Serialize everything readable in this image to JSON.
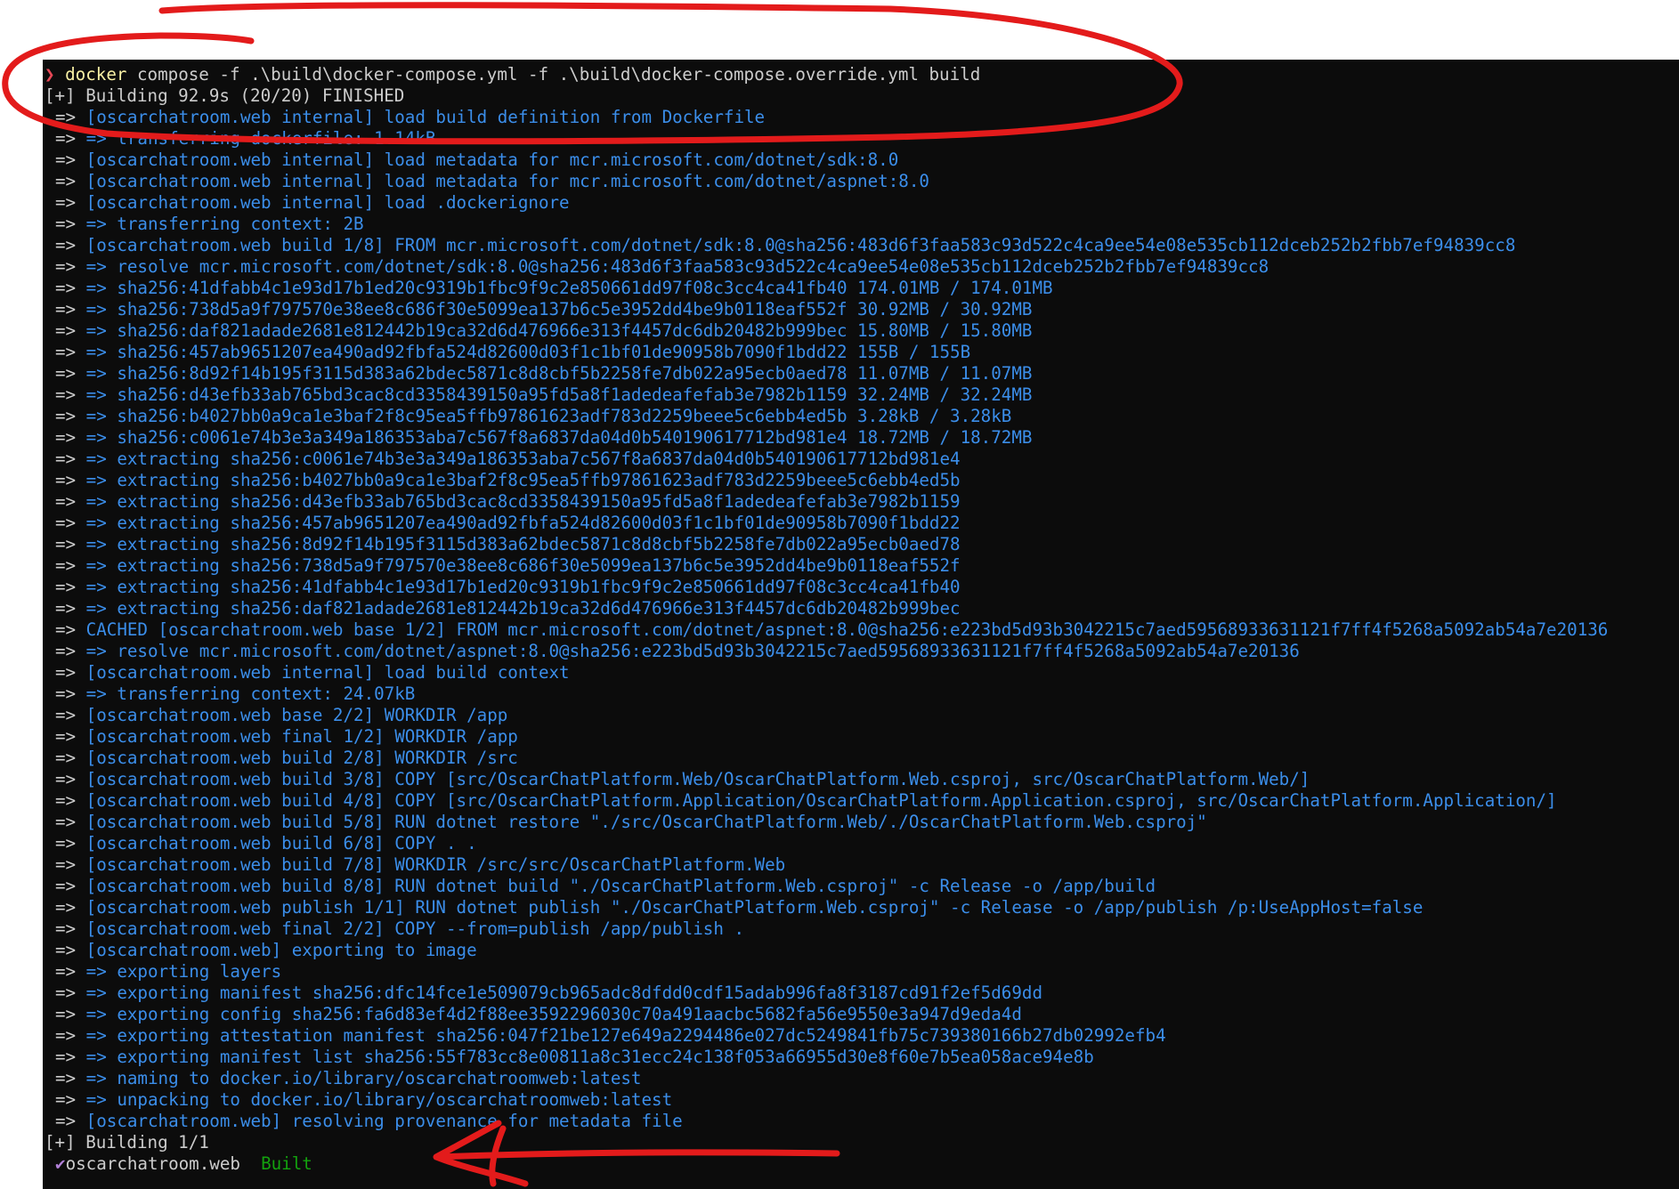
{
  "command": {
    "prompt_symbol": "❯",
    "program": "docker",
    "arguments": "compose -f .\\build\\docker-compose.yml -f .\\build\\docker-compose.override.yml build"
  },
  "build_status": "[+] Building 92.9s (20/20) FINISHED",
  "arrow_glyph": "=>",
  "steps": [
    "[oscarchatroom.web internal] load build definition from Dockerfile",
    "=> transferring dockerfile: 1.14kB",
    "[oscarchatroom.web internal] load metadata for mcr.microsoft.com/dotnet/sdk:8.0",
    "[oscarchatroom.web internal] load metadata for mcr.microsoft.com/dotnet/aspnet:8.0",
    "[oscarchatroom.web internal] load .dockerignore",
    "=> transferring context: 2B",
    "[oscarchatroom.web build 1/8] FROM mcr.microsoft.com/dotnet/sdk:8.0@sha256:483d6f3faa583c93d522c4ca9ee54e08e535cb112dceb252b2fbb7ef94839cc8",
    "=> resolve mcr.microsoft.com/dotnet/sdk:8.0@sha256:483d6f3faa583c93d522c4ca9ee54e08e535cb112dceb252b2fbb7ef94839cc8",
    "=> sha256:41dfabb4c1e93d17b1ed20c9319b1fbc9f9c2e850661dd97f08c3cc4ca41fb40 174.01MB / 174.01MB",
    "=> sha256:738d5a9f797570e38ee8c686f30e5099ea137b6c5e3952dd4be9b0118eaf552f 30.92MB / 30.92MB",
    "=> sha256:daf821adade2681e812442b19ca32d6d476966e313f4457dc6db20482b999bec 15.80MB / 15.80MB",
    "=> sha256:457ab9651207ea490ad92fbfa524d82600d03f1c1bf01de90958b7090f1bdd22 155B / 155B",
    "=> sha256:8d92f14b195f3115d383a62bdec5871c8d8cbf5b2258fe7db022a95ecb0aed78 11.07MB / 11.07MB",
    "=> sha256:d43efb33ab765bd3cac8cd3358439150a95fd5a8f1adedeafefab3e7982b1159 32.24MB / 32.24MB",
    "=> sha256:b4027bb0a9ca1e3baf2f8c95ea5ffb97861623adf783d2259beee5c6ebb4ed5b 3.28kB / 3.28kB",
    "=> sha256:c0061e74b3e3a349a186353aba7c567f8a6837da04d0b540190617712bd981e4 18.72MB / 18.72MB",
    "=> extracting sha256:c0061e74b3e3a349a186353aba7c567f8a6837da04d0b540190617712bd981e4",
    "=> extracting sha256:b4027bb0a9ca1e3baf2f8c95ea5ffb97861623adf783d2259beee5c6ebb4ed5b",
    "=> extracting sha256:d43efb33ab765bd3cac8cd3358439150a95fd5a8f1adedeafefab3e7982b1159",
    "=> extracting sha256:457ab9651207ea490ad92fbfa524d82600d03f1c1bf01de90958b7090f1bdd22",
    "=> extracting sha256:8d92f14b195f3115d383a62bdec5871c8d8cbf5b2258fe7db022a95ecb0aed78",
    "=> extracting sha256:738d5a9f797570e38ee8c686f30e5099ea137b6c5e3952dd4be9b0118eaf552f",
    "=> extracting sha256:41dfabb4c1e93d17b1ed20c9319b1fbc9f9c2e850661dd97f08c3cc4ca41fb40",
    "=> extracting sha256:daf821adade2681e812442b19ca32d6d476966e313f4457dc6db20482b999bec",
    "CACHED [oscarchatroom.web base 1/2] FROM mcr.microsoft.com/dotnet/aspnet:8.0@sha256:e223bd5d93b3042215c7aed59568933631121f7ff4f5268a5092ab54a7e20136",
    "=> resolve mcr.microsoft.com/dotnet/aspnet:8.0@sha256:e223bd5d93b3042215c7aed59568933631121f7ff4f5268a5092ab54a7e20136",
    "[oscarchatroom.web internal] load build context",
    "=> transferring context: 24.07kB",
    "[oscarchatroom.web base 2/2] WORKDIR /app",
    "[oscarchatroom.web final 1/2] WORKDIR /app",
    "[oscarchatroom.web build 2/8] WORKDIR /src",
    "[oscarchatroom.web build 3/8] COPY [src/OscarChatPlatform.Web/OscarChatPlatform.Web.csproj, src/OscarChatPlatform.Web/]",
    "[oscarchatroom.web build 4/8] COPY [src/OscarChatPlatform.Application/OscarChatPlatform.Application.csproj, src/OscarChatPlatform.Application/]",
    "[oscarchatroom.web build 5/8] RUN dotnet restore \"./src/OscarChatPlatform.Web/./OscarChatPlatform.Web.csproj\"",
    "[oscarchatroom.web build 6/8] COPY . .",
    "[oscarchatroom.web build 7/8] WORKDIR /src/src/OscarChatPlatform.Web",
    "[oscarchatroom.web build 8/8] RUN dotnet build \"./OscarChatPlatform.Web.csproj\" -c Release -o /app/build",
    "[oscarchatroom.web publish 1/1] RUN dotnet publish \"./OscarChatPlatform.Web.csproj\" -c Release -o /app/publish /p:UseAppHost=false",
    "[oscarchatroom.web final 2/2] COPY --from=publish /app/publish .",
    "[oscarchatroom.web] exporting to image",
    "=> exporting layers",
    "=> exporting manifest sha256:dfc14fce1e509079cb965adc8dfdd0cdf15adab996fa8f3187cd91f2ef5d69dd",
    "=> exporting config sha256:fa6d83ef4d2f88ee3592296030c70a491aacbc5682fa56e9550e3a947d9eda4d",
    "=> exporting attestation manifest sha256:047f21be127e649a2294486e027dc5249841fb75c739380166b27db02992efb4",
    "=> exporting manifest list sha256:55f783cc8e00811a8c31ecc24c138f053a66955d30e8f60e7b5ea058ace94e8b",
    "=> naming to docker.io/library/oscarchatroomweb:latest",
    "=> unpacking to docker.io/library/oscarchatroomweb:latest",
    "[oscarchatroom.web] resolving provenance for metadata file"
  ],
  "summary_status": "[+] Building 1/1",
  "result": {
    "check_glyph": "✔",
    "service": "oscarchatroom.web",
    "state": "Built"
  },
  "colors": {
    "background": "#0c0c0c",
    "step_text": "#3b8eea",
    "plain_text": "#cccccc",
    "prompt": "#e74856",
    "program": "#f9f1a5",
    "built": "#13a10e",
    "check": "#b180d7",
    "annotation": "#e31b1b"
  }
}
